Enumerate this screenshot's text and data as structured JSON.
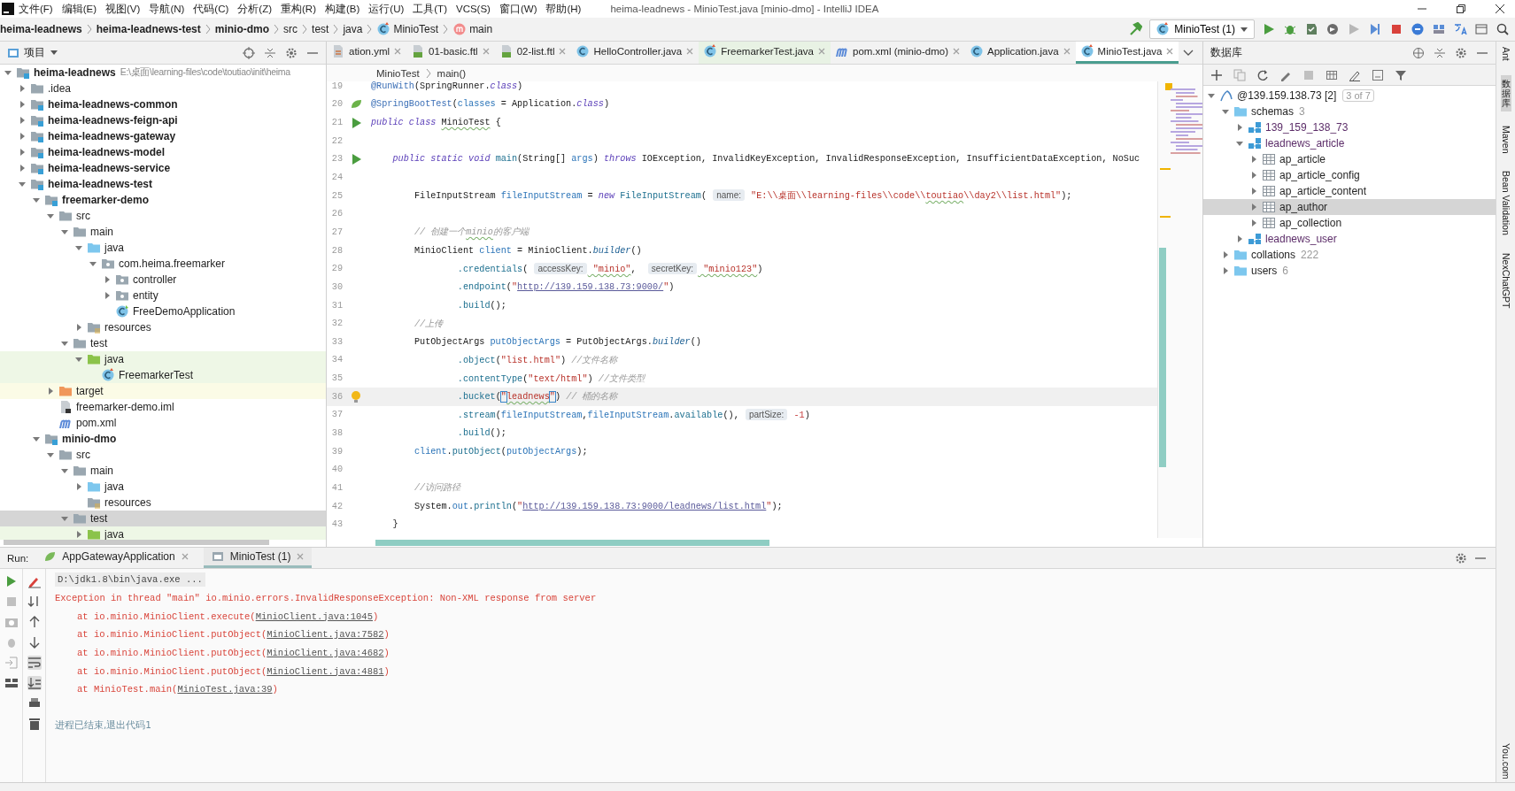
{
  "window": {
    "title": "heima-leadnews - MinioTest.java [minio-dmo] - IntelliJ IDEA"
  },
  "menu": [
    "文件(F)",
    "编辑(E)",
    "视图(V)",
    "导航(N)",
    "代码(C)",
    "分析(Z)",
    "重构(R)",
    "构建(B)",
    "运行(U)",
    "工具(T)",
    "VCS(S)",
    "窗口(W)",
    "帮助(H)"
  ],
  "breadcrumb": [
    {
      "label": "heima-leadnews",
      "kind": "module"
    },
    {
      "label": "heima-leadnews-test",
      "kind": "module"
    },
    {
      "label": "minio-dmo",
      "kind": "module"
    },
    {
      "label": "src",
      "kind": "folder"
    },
    {
      "label": "test",
      "kind": "folder"
    },
    {
      "label": "java",
      "kind": "folder"
    },
    {
      "label": "MinioTest",
      "kind": "class"
    },
    {
      "label": "main",
      "kind": "method"
    }
  ],
  "run_config": {
    "label": "MinioTest (1)"
  },
  "project_panel": {
    "title": "项目",
    "tree": [
      {
        "label": "heima-leadnews",
        "kind": "module",
        "path": "E:\\桌面\\learning-files\\code\\toutiao\\init\\heima",
        "expanded": true,
        "selected": false,
        "children": [
          {
            "label": ".idea",
            "kind": "folder",
            "expanded": false,
            "selected": false
          },
          {
            "label": "heima-leadnews-common",
            "kind": "module",
            "expanded": false,
            "selected": false
          },
          {
            "label": "heima-leadnews-feign-api",
            "kind": "module",
            "expanded": false,
            "selected": false
          },
          {
            "label": "heima-leadnews-gateway",
            "kind": "module",
            "expanded": false,
            "selected": false
          },
          {
            "label": "heima-leadnews-model",
            "kind": "module",
            "expanded": false,
            "selected": false
          },
          {
            "label": "heima-leadnews-service",
            "kind": "module",
            "expanded": false,
            "selected": false
          },
          {
            "label": "heima-leadnews-test",
            "kind": "module",
            "expanded": true,
            "selected": false,
            "children": [
              {
                "label": "freemarker-demo",
                "kind": "module",
                "expanded": true,
                "selected": false,
                "children": [
                  {
                    "label": "src",
                    "kind": "folder",
                    "expanded": true,
                    "selected": false,
                    "children": [
                      {
                        "label": "main",
                        "kind": "folder",
                        "expanded": true,
                        "selected": false,
                        "children": [
                          {
                            "label": "java",
                            "kind": "source",
                            "expanded": true,
                            "selected": false,
                            "children": [
                              {
                                "label": "com.heima.freemarker",
                                "kind": "package",
                                "expanded": true,
                                "selected": false,
                                "children": [
                                  {
                                    "label": "controller",
                                    "kind": "package",
                                    "expanded": false,
                                    "selected": false
                                  },
                                  {
                                    "label": "entity",
                                    "kind": "package",
                                    "expanded": false,
                                    "selected": false
                                  },
                                  {
                                    "label": "FreeDemoApplication",
                                    "kind": "springclass",
                                    "selected": false
                                  }
                                ]
                              }
                            ]
                          },
                          {
                            "label": "resources",
                            "kind": "resources",
                            "expanded": false,
                            "selected": false
                          }
                        ]
                      },
                      {
                        "label": "test",
                        "kind": "folder",
                        "expanded": true,
                        "selected": false,
                        "children": [
                          {
                            "label": "java",
                            "kind": "testroot",
                            "expanded": true,
                            "selected": false,
                            "children": [
                              {
                                "label": "FreemarkerTest",
                                "kind": "testclass",
                                "selected": false
                              }
                            ]
                          }
                        ]
                      }
                    ]
                  },
                  {
                    "label": "target",
                    "kind": "excluded",
                    "expanded": false,
                    "selected": false
                  },
                  {
                    "label": "freemarker-demo.iml",
                    "kind": "iml",
                    "selected": false
                  },
                  {
                    "label": "pom.xml",
                    "kind": "maven",
                    "selected": false
                  }
                ]
              },
              {
                "label": "minio-dmo",
                "kind": "module",
                "expanded": true,
                "selected": false,
                "children": [
                  {
                    "label": "src",
                    "kind": "folder",
                    "expanded": true,
                    "selected": false,
                    "children": [
                      {
                        "label": "main",
                        "kind": "folder",
                        "expanded": true,
                        "selected": false,
                        "children": [
                          {
                            "label": "java",
                            "kind": "source",
                            "expanded": false,
                            "selected": false
                          },
                          {
                            "label": "resources",
                            "kind": "resources",
                            "selected": false
                          }
                        ]
                      },
                      {
                        "label": "test",
                        "kind": "folder",
                        "expanded": true,
                        "selected": true,
                        "children": [
                          {
                            "label": "java",
                            "kind": "testroot",
                            "expanded": false,
                            "selected": false
                          }
                        ]
                      }
                    ]
                  }
                ]
              }
            ]
          }
        ]
      }
    ]
  },
  "editor": {
    "tabs": [
      {
        "label": "ation.yml",
        "kind": "yaml",
        "selected": false
      },
      {
        "label": "01-basic.ftl",
        "kind": "ftl",
        "selected": false
      },
      {
        "label": "02-list.ftl",
        "kind": "ftl",
        "selected": false
      },
      {
        "label": "HelloController.java",
        "kind": "class",
        "selected": false
      },
      {
        "label": "FreemarkerTest.java",
        "kind": "testclass",
        "selected": false
      },
      {
        "label": "pom.xml (minio-dmo)",
        "kind": "maven",
        "selected": false
      },
      {
        "label": "Application.java",
        "kind": "class",
        "selected": false
      },
      {
        "label": "MinioTest.java",
        "kind": "testclass",
        "selected": true
      }
    ],
    "breadcrumb": [
      "MinioTest",
      "main()"
    ],
    "lines": [
      {
        "number": "19",
        "current": false,
        "tokens": [
          {
            "kind": "annotation",
            "text": "@RunWith"
          },
          {
            "kind": "plain",
            "text": "(SpringRunner."
          },
          {
            "kind": "keyword",
            "text": "class"
          },
          {
            "kind": "plain",
            "text": ")"
          }
        ]
      },
      {
        "number": "20",
        "kind": "bean",
        "current": false,
        "tokens": [
          {
            "kind": "annotation",
            "text": "@SpringBootTest"
          },
          {
            "kind": "plain",
            "text": "("
          },
          {
            "kind": "variable",
            "text": "classes"
          },
          {
            "kind": "plain",
            "text": " = Application."
          },
          {
            "kind": "keyword",
            "text": "class"
          },
          {
            "kind": "plain",
            "text": ")"
          }
        ]
      },
      {
        "number": "21",
        "kind": "run",
        "current": false,
        "tokens": [
          {
            "kind": "keyword",
            "text": "public class "
          },
          {
            "kind": "typo",
            "text": "MinioTest"
          },
          {
            "kind": "plain",
            "text": " {"
          }
        ]
      },
      {
        "number": "22",
        "current": false
      },
      {
        "number": "23",
        "kind": "run",
        "current": false,
        "tokens": [
          {
            "kind": "keyword",
            "text": "    public static void "
          },
          {
            "kind": "method",
            "text": "main"
          },
          {
            "kind": "plain",
            "text": "(String[] "
          },
          {
            "kind": "variable",
            "text": "args"
          },
          {
            "kind": "plain",
            "text": ") "
          },
          {
            "kind": "keyword",
            "text": "throws "
          },
          {
            "kind": "plain",
            "text": "IOException, InvalidKeyException, InvalidResponseException, InsufficientDataException, NoSuc"
          }
        ]
      },
      {
        "number": "24",
        "current": false
      },
      {
        "number": "25",
        "current": false,
        "tokens": [
          {
            "kind": "plain",
            "text": "        FileInputStream "
          },
          {
            "kind": "variable",
            "text": "fileInputStream"
          },
          {
            "kind": "plain",
            "text": " = "
          },
          {
            "kind": "keyword",
            "text": "new "
          },
          {
            "kind": "method",
            "text": "FileInputStream"
          },
          {
            "kind": "plain",
            "text": "( "
          },
          {
            "kind": "hint",
            "text": "name:"
          },
          {
            "kind": "string",
            "text": " \"E:\\\\桌面\\\\learning-files\\\\code\\\\"
          },
          {
            "kind": "typostring",
            "text": "toutiao"
          },
          {
            "kind": "string",
            "text": "\\\\day2\\\\list.html\""
          },
          {
            "kind": "plain",
            "text": ");"
          }
        ]
      },
      {
        "number": "26",
        "current": false
      },
      {
        "number": "27",
        "current": false,
        "tokens": [
          {
            "kind": "comment",
            "text": "        // 创建一个"
          },
          {
            "kind": "typocomment",
            "text": "minio"
          },
          {
            "kind": "comment",
            "text": "的客户端"
          }
        ]
      },
      {
        "number": "28",
        "current": false,
        "tokens": [
          {
            "kind": "plain",
            "text": "        MinioClient "
          },
          {
            "kind": "variable",
            "text": "client"
          },
          {
            "kind": "plain",
            "text": " = MinioClient."
          },
          {
            "kind": "static",
            "text": "builder"
          },
          {
            "kind": "plain",
            "text": "()"
          }
        ]
      },
      {
        "number": "29",
        "current": false,
        "tokens": [
          {
            "kind": "method",
            "text": "                .credentials"
          },
          {
            "kind": "plain",
            "text": "( "
          },
          {
            "kind": "hint",
            "text": "accessKey:"
          },
          {
            "kind": "typostring",
            "text": " \"minio\""
          },
          {
            "kind": "plain",
            "text": ",  "
          },
          {
            "kind": "hint",
            "text": "secretKey:"
          },
          {
            "kind": "typostring",
            "text": " \"minio123\""
          },
          {
            "kind": "plain",
            "text": ")"
          }
        ]
      },
      {
        "number": "30",
        "current": false,
        "tokens": [
          {
            "kind": "method",
            "text": "                .endpoint"
          },
          {
            "kind": "plain",
            "text": "("
          },
          {
            "kind": "string",
            "text": "\""
          },
          {
            "kind": "url",
            "text": "http://139.159.138.73:9000/"
          },
          {
            "kind": "string",
            "text": "\""
          },
          {
            "kind": "plain",
            "text": ")"
          }
        ]
      },
      {
        "number": "31",
        "current": false,
        "tokens": [
          {
            "kind": "method",
            "text": "                .build"
          },
          {
            "kind": "plain",
            "text": "();"
          }
        ]
      },
      {
        "number": "32",
        "current": false,
        "tokens": [
          {
            "kind": "comment",
            "text": "        //上传"
          }
        ]
      },
      {
        "number": "33",
        "current": false,
        "tokens": [
          {
            "kind": "plain",
            "text": "        PutObjectArgs "
          },
          {
            "kind": "variable",
            "text": "putObjectArgs"
          },
          {
            "kind": "plain",
            "text": " = PutObjectArgs."
          },
          {
            "kind": "static",
            "text": "builder"
          },
          {
            "kind": "plain",
            "text": "()"
          }
        ]
      },
      {
        "number": "34",
        "current": false,
        "tokens": [
          {
            "kind": "method",
            "text": "                .object"
          },
          {
            "kind": "plain",
            "text": "("
          },
          {
            "kind": "string",
            "text": "\"list.html\""
          },
          {
            "kind": "plain",
            "text": ") "
          },
          {
            "kind": "comment",
            "text": "//文件名称"
          }
        ]
      },
      {
        "number": "35",
        "current": false,
        "tokens": [
          {
            "kind": "method",
            "text": "                .contentType"
          },
          {
            "kind": "plain",
            "text": "("
          },
          {
            "kind": "string",
            "text": "\"text/html\""
          },
          {
            "kind": "plain",
            "text": ") "
          },
          {
            "kind": "comment",
            "text": "//文件类型"
          }
        ]
      },
      {
        "number": "36",
        "kind": "bulb",
        "current": true,
        "tokens": [
          {
            "kind": "method",
            "text": "                .bucket"
          },
          {
            "kind": "plain",
            "text": "("
          },
          {
            "kind": "matched",
            "text": "\""
          },
          {
            "kind": "typostring",
            "text": "leadnews"
          },
          {
            "kind": "matched",
            "text": "\""
          },
          {
            "kind": "plain",
            "text": ") "
          },
          {
            "kind": "comment",
            "text": "// 桶的名称"
          }
        ]
      },
      {
        "number": "37",
        "current": false,
        "tokens": [
          {
            "kind": "method",
            "text": "                .stream"
          },
          {
            "kind": "plain",
            "text": "("
          },
          {
            "kind": "variable",
            "text": "fileInputStream"
          },
          {
            "kind": "plain",
            "text": ","
          },
          {
            "kind": "variable",
            "text": "fileInputStream"
          },
          {
            "kind": "plain",
            "text": "."
          },
          {
            "kind": "method",
            "text": "available"
          },
          {
            "kind": "plain",
            "text": "(), "
          },
          {
            "kind": "hint",
            "text": "partSize:"
          },
          {
            "kind": "number",
            "text": " -1"
          },
          {
            "kind": "plain",
            "text": ")"
          }
        ]
      },
      {
        "number": "38",
        "current": false,
        "tokens": [
          {
            "kind": "method",
            "text": "                .build"
          },
          {
            "kind": "plain",
            "text": "();"
          }
        ]
      },
      {
        "number": "39",
        "current": false,
        "tokens": [
          {
            "kind": "variable",
            "text": "        client"
          },
          {
            "kind": "plain",
            "text": "."
          },
          {
            "kind": "method",
            "text": "putObject"
          },
          {
            "kind": "plain",
            "text": "("
          },
          {
            "kind": "variable",
            "text": "putObjectArgs"
          },
          {
            "kind": "plain",
            "text": ");"
          }
        ]
      },
      {
        "number": "40",
        "current": false
      },
      {
        "number": "41",
        "current": false,
        "tokens": [
          {
            "kind": "comment",
            "text": "        //访问路径"
          }
        ]
      },
      {
        "number": "42",
        "current": false,
        "tokens": [
          {
            "kind": "plain",
            "text": "        System."
          },
          {
            "kind": "variable",
            "text": "out"
          },
          {
            "kind": "plain",
            "text": "."
          },
          {
            "kind": "method",
            "text": "println"
          },
          {
            "kind": "plain",
            "text": "("
          },
          {
            "kind": "string",
            "text": "\""
          },
          {
            "kind": "url",
            "text": "http://139.159.138.73:9000/leadnews/list.html"
          },
          {
            "kind": "string",
            "text": "\""
          },
          {
            "kind": "plain",
            "text": ");"
          }
        ]
      },
      {
        "number": "43",
        "current": false,
        "tokens": [
          {
            "kind": "plain",
            "text": "    }"
          }
        ]
      }
    ]
  },
  "database_panel": {
    "title": "数据库",
    "tree": [
      {
        "label": "@139.159.138.73 [2]",
        "kind": "datasource",
        "badge": "3 of 7",
        "expanded": true,
        "selected": false,
        "children": [
          {
            "label": "schemas",
            "kind": "group",
            "count": "3",
            "expanded": true,
            "selected": false,
            "children": [
              {
                "label": "139_159_138_73",
                "kind": "schema",
                "expanded": false,
                "selected": false
              },
              {
                "label": "leadnews_article",
                "kind": "schema",
                "expanded": true,
                "selected": false,
                "children": [
                  {
                    "label": "ap_article",
                    "kind": "table",
                    "expanded": false,
                    "selected": false
                  },
                  {
                    "label": "ap_article_config",
                    "kind": "table",
                    "expanded": false,
                    "selected": false
                  },
                  {
                    "label": "ap_article_content",
                    "kind": "table",
                    "expanded": false,
                    "selected": false
                  },
                  {
                    "label": "ap_author",
                    "kind": "table",
                    "expanded": false,
                    "selected": true
                  },
                  {
                    "label": "ap_collection",
                    "kind": "table",
                    "expanded": false,
                    "selected": false
                  }
                ]
              },
              {
                "label": "leadnews_user",
                "kind": "schema",
                "expanded": false,
                "selected": false
              }
            ]
          },
          {
            "label": "collations",
            "kind": "group",
            "count": "222",
            "expanded": false,
            "selected": false
          },
          {
            "label": "users",
            "kind": "group",
            "count": "6",
            "expanded": false,
            "selected": false
          }
        ]
      }
    ]
  },
  "right_stripe": [
    {
      "label": "Ant",
      "kind": "latin",
      "selected": false
    },
    {
      "label": "数据库",
      "kind": "cjk",
      "selected": true
    },
    {
      "label": "Maven",
      "kind": "latin",
      "selected": false
    },
    {
      "label": "Bean Validation",
      "kind": "latin",
      "selected": false
    },
    {
      "label": "NexChatGPT",
      "kind": "latin",
      "selected": false
    },
    {
      "label": "You.com",
      "kind": "latin",
      "selected": false
    }
  ],
  "run_panel": {
    "title": "Run:",
    "tabs": [
      {
        "label": "AppGatewayApplication",
        "kind": "spring",
        "selected": false
      },
      {
        "label": "MinioTest (1)",
        "kind": "test",
        "selected": true
      }
    ],
    "console": [
      {
        "kind": "command",
        "parts": [
          {
            "text": "D:\\jdk1.8\\bin\\java.exe ...",
            "link": false
          }
        ]
      },
      {
        "kind": "error",
        "parts": [
          {
            "text": "Exception in thread \"main\" io.minio.errors.InvalidResponseException: Non-XML response from server",
            "link": false
          }
        ]
      },
      {
        "kind": "stack",
        "parts": [
          {
            "text": "at io.minio.MinioClient.execute(",
            "link": false
          },
          {
            "text": "MinioClient.java:1045",
            "link": true
          },
          {
            "text": ")",
            "link": false
          }
        ]
      },
      {
        "kind": "stack",
        "parts": [
          {
            "text": "at io.minio.MinioClient.putObject(",
            "link": false
          },
          {
            "text": "MinioClient.java:7582",
            "link": true
          },
          {
            "text": ")",
            "link": false
          }
        ]
      },
      {
        "kind": "stack",
        "parts": [
          {
            "text": "at io.minio.MinioClient.putObject(",
            "link": false
          },
          {
            "text": "MinioClient.java:4682",
            "link": true
          },
          {
            "text": ")",
            "link": false
          }
        ]
      },
      {
        "kind": "stack",
        "parts": [
          {
            "text": "at io.minio.MinioClient.putObject(",
            "link": false
          },
          {
            "text": "MinioClient.java:4881",
            "link": true
          },
          {
            "text": ")",
            "link": false
          }
        ]
      },
      {
        "kind": "stack",
        "parts": [
          {
            "text": "at MinioTest.main(",
            "link": false
          },
          {
            "text": "MinioTest.java:39",
            "link": true
          },
          {
            "text": ")",
            "link": false
          }
        ]
      },
      {
        "kind": "info",
        "parts": [
          {
            "text": "进程已结束,退出代码1",
            "link": false
          }
        ]
      }
    ]
  }
}
